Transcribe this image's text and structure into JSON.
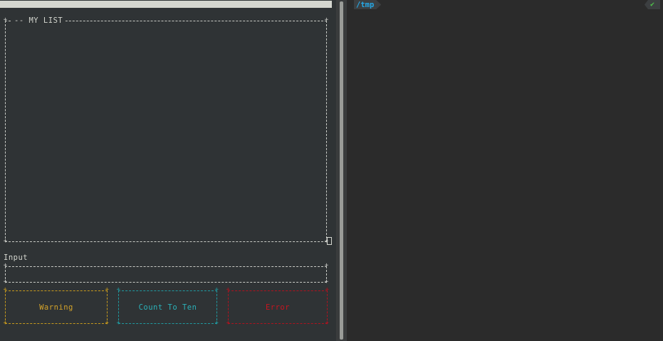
{
  "list": {
    "title": "-- MY LIST"
  },
  "input": {
    "label": "Input"
  },
  "buttons": {
    "warning": "Warning",
    "count": "Count To Ten",
    "error": "Error"
  },
  "prompt": {
    "path": "/tmp",
    "status": "✔"
  },
  "colors": {
    "warning": "#d4a32a",
    "count": "#2bb1b8",
    "error": "#c8141f",
    "path": "#26a8e6",
    "status_ok": "#4ec14a"
  }
}
